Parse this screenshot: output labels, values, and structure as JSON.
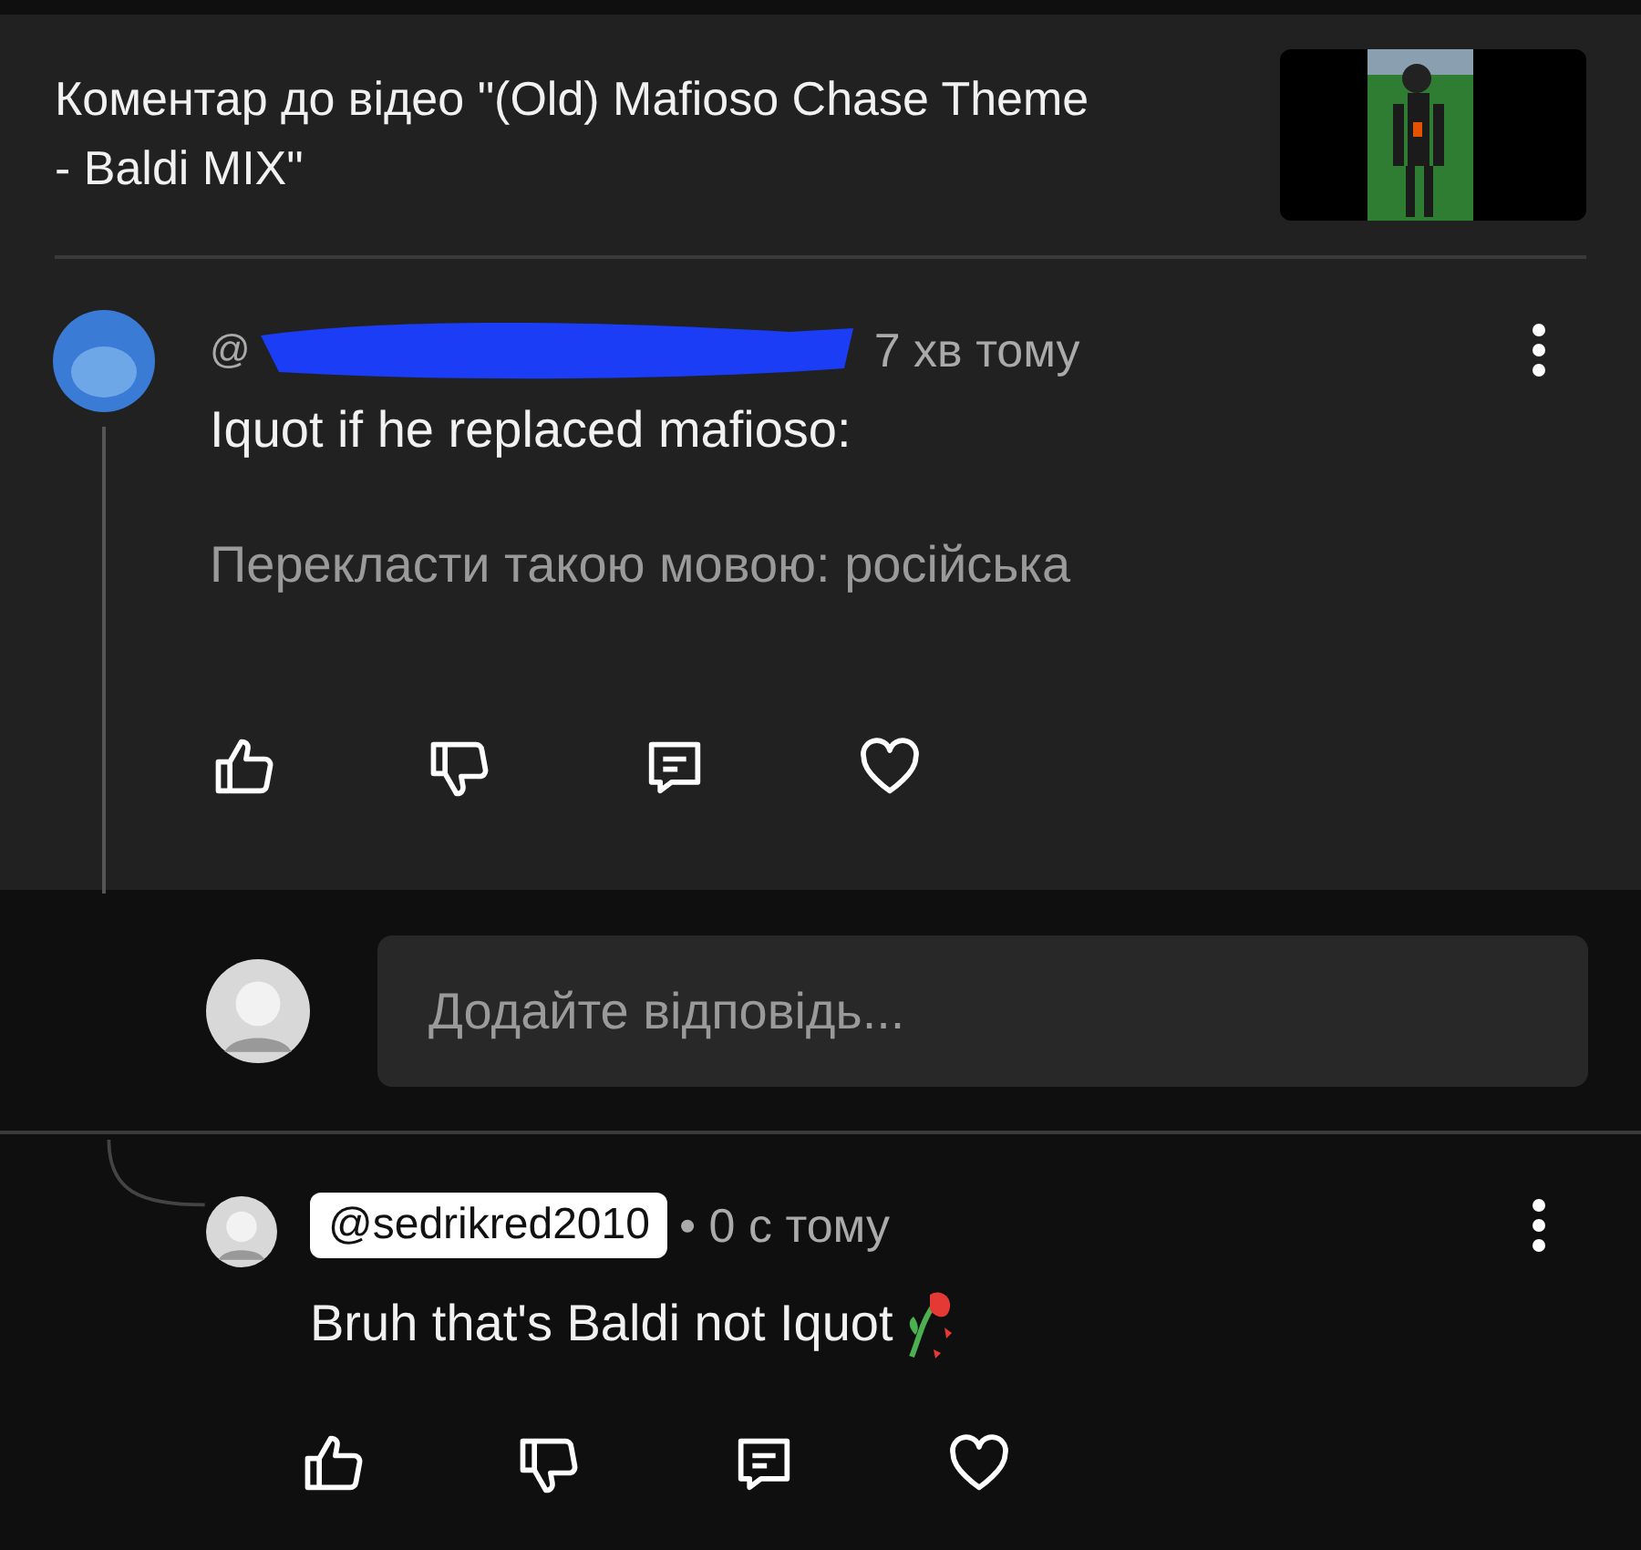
{
  "header": {
    "title": "Коментар до відео \"(Old) Mafioso Chase Theme - Baldi MIX\""
  },
  "comment": {
    "handle": "@",
    "time": "7 хв тому",
    "text": "Iquot if he replaced mafioso:",
    "translate": "Перекласти такою мовою: російська",
    "liked": false,
    "hearted": false
  },
  "reply_box": {
    "placeholder": "Додайте відповідь..."
  },
  "replies": [
    {
      "handle": "@sedrikred2010",
      "time": "• 0 с тому",
      "text": "Bruh that's Baldi not Iquot",
      "highlighted": true,
      "liked": false,
      "hearted": false
    }
  ]
}
